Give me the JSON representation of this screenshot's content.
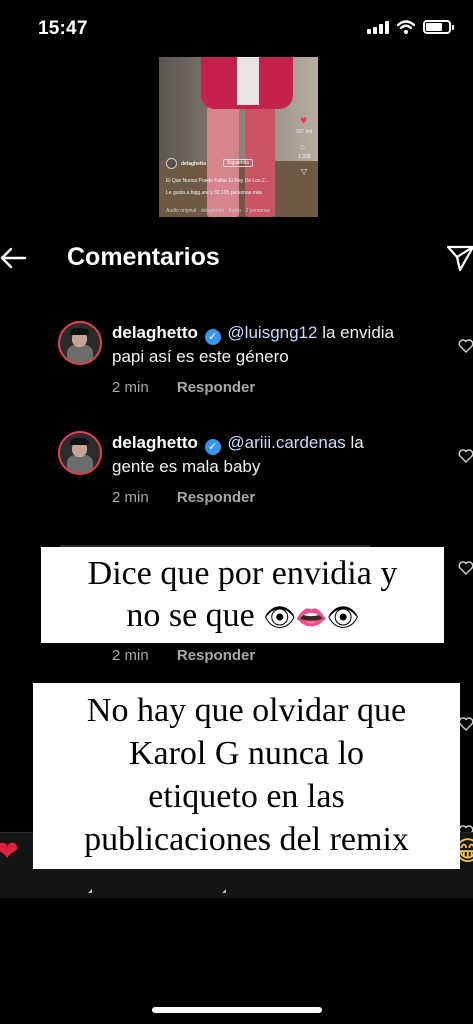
{
  "status_bar": {
    "time": "15:47"
  },
  "post_thumbnail": {
    "likes": "337 mil",
    "comments": "1,328",
    "username": "delaghetto",
    "follow_label": "Siguiendo",
    "caption": "El Que Nunca Puede Faltar El Rey De Los 2...",
    "liked_by": "Le gusta a bigg.are y 32,195 personas más",
    "audio": "Audio original · delaghetto · Audio · 2 personas"
  },
  "header": {
    "title": "Comentarios"
  },
  "comments": [
    {
      "username": "delaghetto",
      "mention": "@luisgng12",
      "text_1": " la envidia",
      "text_2": "papi así es este género",
      "time": "2 min",
      "reply_label": "Responder"
    },
    {
      "username": "delaghetto",
      "mention": "@ariii.cardenas",
      "text_1": " la",
      "text_2": "gente es mala baby",
      "time": "2 min",
      "reply_label": "Responder"
    },
    {
      "time": "2 min",
      "reply_label": "Responder"
    }
  ],
  "captions": {
    "first_line_1": "Dice que por envidia y",
    "first_line_2": "no se que",
    "first_emojis": "👁👄👁",
    "second_line_1": "No hay que olvidar que",
    "second_line_2": "Karol G nunca lo",
    "second_line_3": "etiqueto en las",
    "second_line_4": "publicaciones del remix"
  },
  "emoji_bar": {
    "emojis": [
      "❤",
      "🙌",
      "🔥",
      "👏",
      "😢",
      "😍",
      "😮",
      "😂"
    ]
  },
  "colors": {
    "verified": "#3797f0",
    "avatar_ring": "#e64056",
    "background": "#000000"
  }
}
